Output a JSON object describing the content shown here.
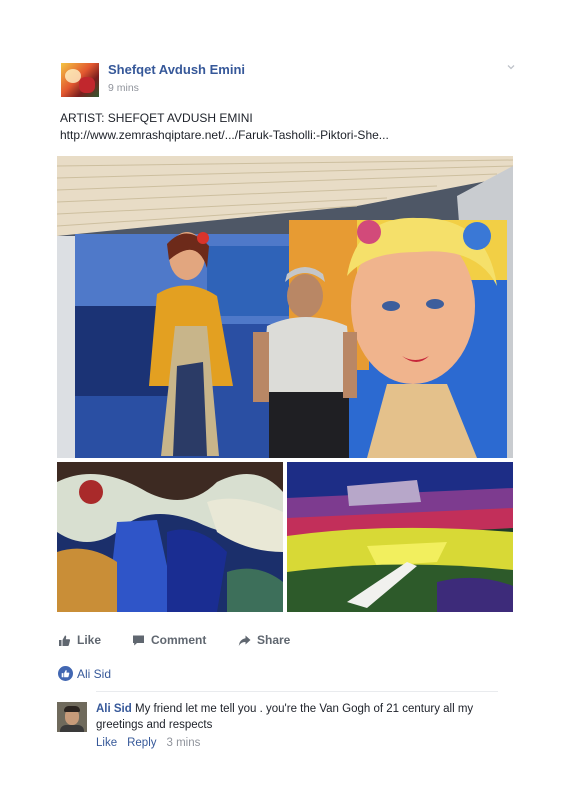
{
  "post": {
    "author": "Shefqet Avdush Emini",
    "time": "9 mins",
    "text_line1": "ARTIST: SHEFQET AVDUSH EMINI",
    "link": "http://www.zemrashqiptare.net/.../Faruk-Tasholli:-Piktori-She..."
  },
  "actions": {
    "like": "Like",
    "comment": "Comment",
    "share": "Share"
  },
  "likes": {
    "names": "Ali Sid"
  },
  "comment": {
    "author": "Ali Sid",
    "text": "My friend let me tell you . you're the Van Gogh of 21 century all my greetings and respects",
    "like": "Like",
    "reply": "Reply",
    "time": "3 mins"
  },
  "colors": {
    "link_blue": "#365899",
    "action_gray": "#606770",
    "like_badge": "#4267b2"
  },
  "icons": {
    "like": "thumbs-up-icon",
    "comment": "speech-bubble-icon",
    "share": "share-arrow-icon",
    "menu": "chevron-down-icon"
  }
}
